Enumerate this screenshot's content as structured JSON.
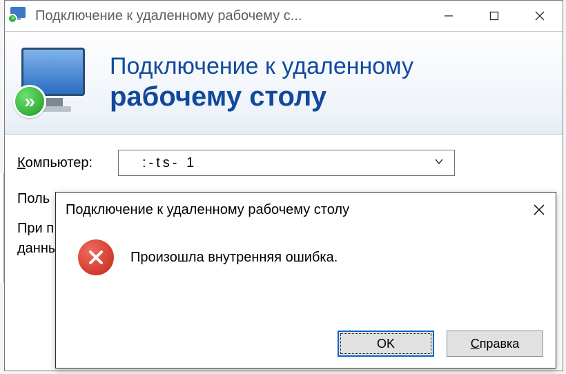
{
  "titlebar": {
    "title": "Подключение к удаленному рабочему с..."
  },
  "banner": {
    "line1": "Подключение к удаленному",
    "line2": "рабочему столу",
    "badge_glyph": "»"
  },
  "form": {
    "computer_label_underline": "К",
    "computer_label_rest": "омпьютер:",
    "computer_value": ":-ts-         1",
    "user_label_prefix": "Поль",
    "pre_connect_text": "При п",
    "pre_connect_text2": "данны"
  },
  "dialog": {
    "title": "Подключение к удаленному рабочему столу",
    "message": "Произошла внутренняя ошибка.",
    "ok_label": "OK",
    "help_label_underline": "С",
    "help_label_rest": "правка"
  }
}
